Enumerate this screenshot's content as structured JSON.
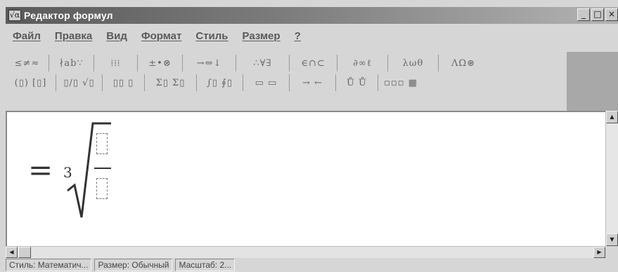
{
  "window": {
    "title": "Редактор формул",
    "app_icon_glyph": "√α",
    "controls": [
      "_",
      "□",
      "×"
    ]
  },
  "menu": {
    "items": [
      "Файл",
      "Правка",
      "Вид",
      "Формат",
      "Стиль",
      "Размер",
      "?"
    ]
  },
  "toolbar": {
    "row1": [
      "≤≠≈",
      "∤ab∵",
      "⁞⁞⁞",
      "±•⊗",
      "→⇔↓",
      "∴∀∃",
      "∈∩⊂",
      "∂∞ℓ",
      "λωθ",
      "ΛΩ⊛"
    ],
    "row2": [
      "(▯) [▯]",
      "▯/▯ √▯",
      "▯▯ ▯",
      "Σ▯ Σ▯",
      "∫▯ ∮▯",
      "▭ ▭",
      "→ ←",
      "Ů Ů",
      "▫▫▫ ▦"
    ]
  },
  "formula": {
    "equals": "=",
    "root_index": "3"
  },
  "status": {
    "style": "Стиль: Математич...",
    "size": "Размер: Обычный",
    "zoom": "Масштаб: 2..."
  },
  "colors": {
    "titlebar_start": "#5a5a5a",
    "titlebar_end": "#b3b3b3",
    "editor_bg": "#ffffff",
    "chrome": "#d6d6d6"
  }
}
